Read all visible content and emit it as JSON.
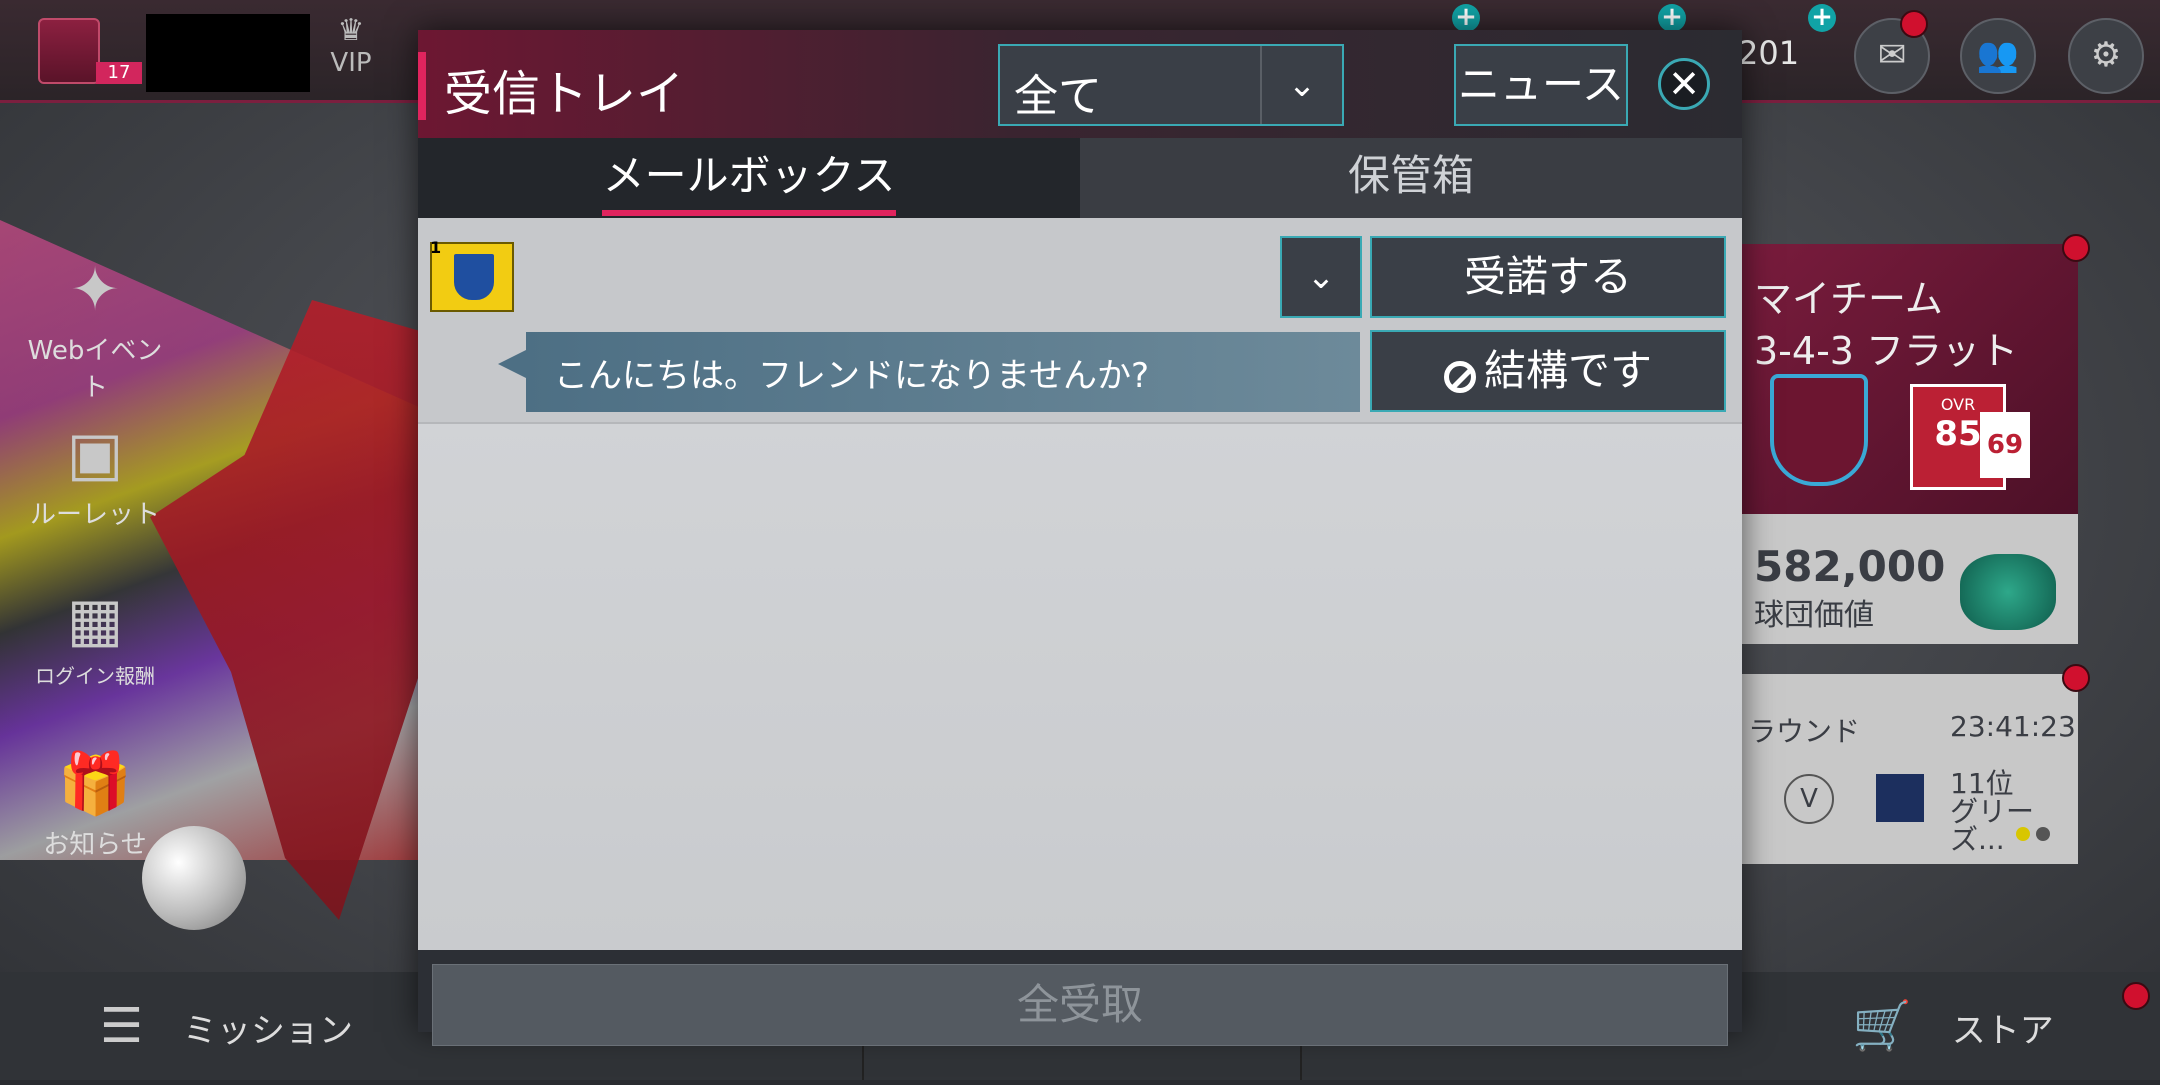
{
  "topbar": {
    "level": "17",
    "vip_label": "VIP",
    "currency_value": "201"
  },
  "side_menu": [
    {
      "label": "Webイベント",
      "icon": "party-popper-icon"
    },
    {
      "label": "ルーレット",
      "icon": "roulette-icon"
    },
    {
      "label": "ログイン報酬",
      "icon": "calendar-icon"
    },
    {
      "label": "お知らせ",
      "icon": "gift-icon"
    }
  ],
  "cards": {
    "team_title": "マイチーム",
    "formation": "3-4-3 フラット",
    "ovr_label": "OVR",
    "ovr_value": "85",
    "ovr_secondary": "69",
    "club_value": "582,000",
    "club_value_label": "球団価値",
    "round_label": "ラウンド",
    "round_timer": "23:41:23",
    "vs_label": "V",
    "opponent_rank": "11位",
    "opponent_name": "グリーズ..."
  },
  "bottom_bar": {
    "mission_label": "ミッション",
    "store_label": "ストア"
  },
  "dialog": {
    "title": "受信トレイ",
    "filter_value": "全て",
    "news_button": "ニュース",
    "tabs": [
      {
        "label": "メールボックス",
        "active": true
      },
      {
        "label": "保管箱",
        "active": false
      }
    ],
    "messages": [
      {
        "avatar_badge": "1",
        "text": "こんにちは。フレンドになりませんか?",
        "accept_label": "受諾する",
        "decline_label": "結構です"
      }
    ],
    "claim_all_label": "全受取"
  },
  "colors": {
    "accent_pink": "#e0245e",
    "accent_teal": "#3aa9b4",
    "notification_red": "#d0102e"
  }
}
